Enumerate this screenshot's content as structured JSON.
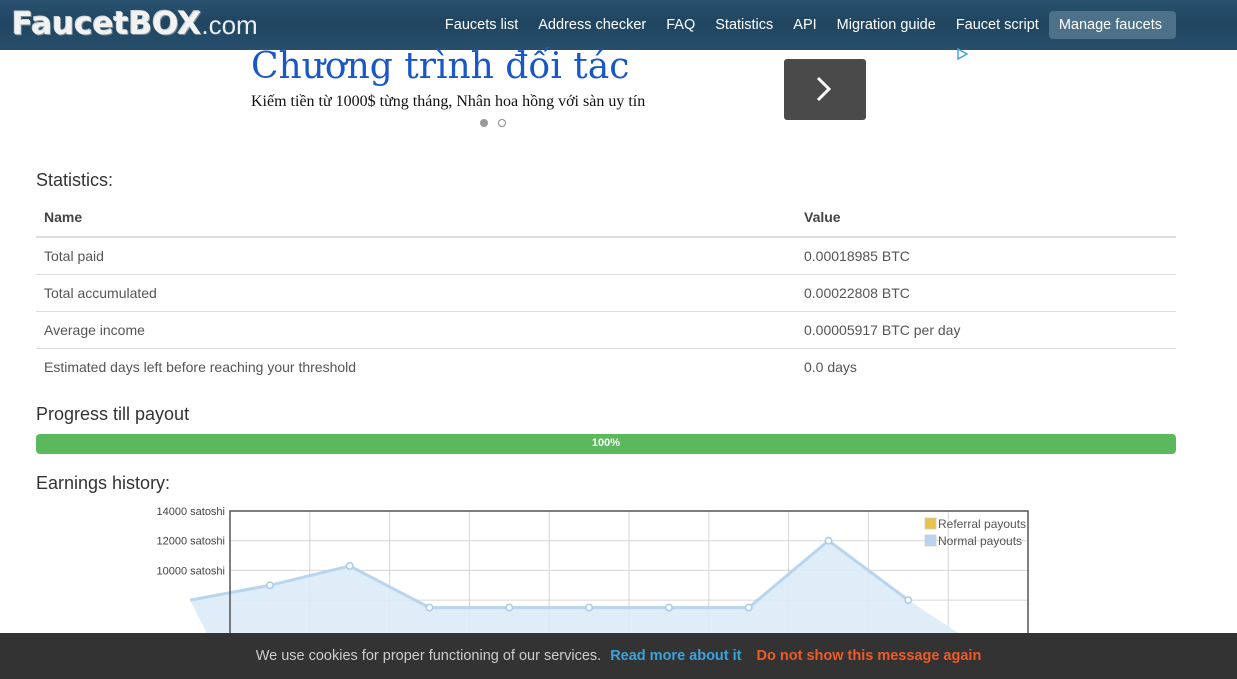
{
  "brand": {
    "name": "FaucetBOX",
    "suffix": ".com"
  },
  "nav": [
    "Faucets list",
    "Address checker",
    "FAQ",
    "Statistics",
    "API",
    "Migration guide",
    "Faucet script",
    "Manage faucets"
  ],
  "ad": {
    "title": "Chương trình đối tác",
    "subtitle": "Kiếm tiền từ 1000$ từng tháng, Nhân hoa hồng với sàn uy tín"
  },
  "statistics": {
    "heading": "Statistics:",
    "columns": [
      "Name",
      "Value"
    ],
    "rows": [
      {
        "name": "Total paid",
        "value": "0.00018985 BTC"
      },
      {
        "name": "Total accumulated",
        "value": "0.00022808 BTC"
      },
      {
        "name": "Average income",
        "value": "0.00005917 BTC per day"
      },
      {
        "name": "Estimated days left before reaching your threshold",
        "value": "0.0 days"
      }
    ]
  },
  "progress": {
    "heading": "Progress till payout",
    "label": "100%",
    "fraction": 1.0
  },
  "earnings": {
    "heading": "Earnings history:"
  },
  "chart_data": {
    "type": "area",
    "y_tick_labels": [
      "14000 satoshi",
      "12000 satoshi",
      "10000 satoshi"
    ],
    "ylim": [
      0,
      14000
    ],
    "grid": true,
    "legend_placement": "top-right",
    "series": [
      {
        "name": "Referral payouts",
        "color": "#e8c34a",
        "values": [
          0,
          0,
          0,
          0,
          0,
          0,
          0,
          0,
          0,
          0
        ]
      },
      {
        "name": "Normal payouts",
        "color": "#b9d5ee",
        "values": [
          8000,
          9000,
          10300,
          7500,
          7500,
          7500,
          7500,
          7500,
          12000,
          8000
        ]
      }
    ]
  },
  "cookie": {
    "text": "We use cookies for proper functioning of our services.",
    "read_more": "Read more about it",
    "dismiss": "Do not show this message again"
  },
  "colors": {
    "nav_bg": "#234a66",
    "progress": "#5cb85c",
    "cookie_bg": "#333333",
    "link": "#3aa2dc",
    "dismiss": "#f05a28"
  }
}
